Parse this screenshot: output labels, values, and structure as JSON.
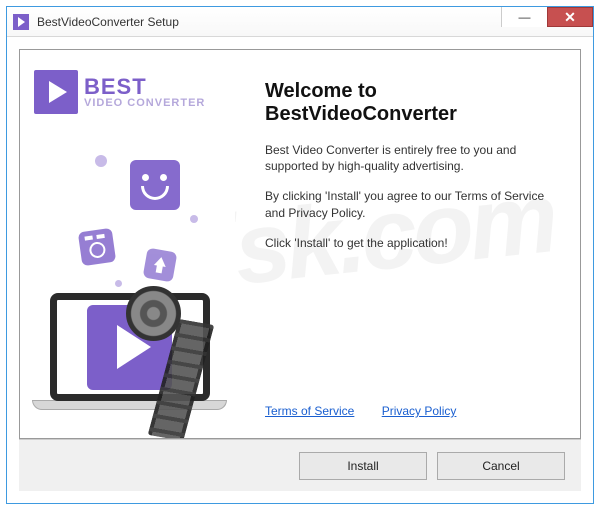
{
  "titlebar": {
    "title": "BestVideoConverter Setup"
  },
  "brand": {
    "line1": "BEST",
    "line2": "VIDEO CONVERTER"
  },
  "main": {
    "heading": "Welcome to BestVideoConverter",
    "para1": "Best Video Converter is entirely free to you and supported by high-quality advertising.",
    "para2": "By clicking 'Install' you agree to our Terms of Service and Privacy Policy.",
    "para3": "Click 'Install' to get the application!"
  },
  "links": {
    "terms": "Terms of Service",
    "privacy": "Privacy Policy"
  },
  "buttons": {
    "install": "Install",
    "cancel": "Cancel"
  },
  "watermark": "PCrisk.com"
}
